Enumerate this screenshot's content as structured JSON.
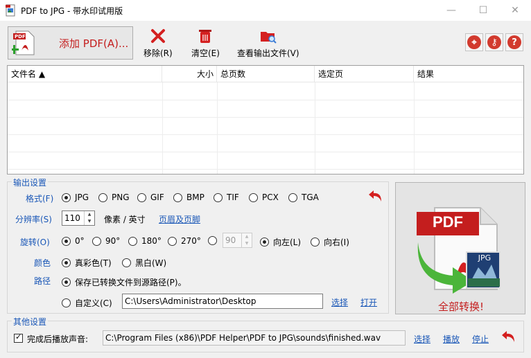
{
  "window": {
    "title": "PDF to JPG - 带水印试用版"
  },
  "toolbar": {
    "add_pdf": "添加 PDF(A)...",
    "remove": "移除(R)",
    "clear": "清空(E)",
    "view_output": "查看输出文件(V)"
  },
  "file_list": {
    "columns": [
      "文件名 ▲",
      "大小",
      "总页数",
      "选定页",
      "结果"
    ],
    "rows": []
  },
  "output_settings": {
    "title": "输出设置",
    "format_label": "格式(F)",
    "formats": [
      "JPG",
      "PNG",
      "GIF",
      "BMP",
      "TIF",
      "PCX",
      "TGA"
    ],
    "selected_format": "JPG",
    "resolution_label": "分辨率(S)",
    "resolution_value": "110",
    "resolution_unit": "像素 / 英寸",
    "header_footer_link": "页眉及页脚",
    "rotation_label": "旋转(O)",
    "rotations": [
      "0°",
      "90°",
      "180°",
      "270°"
    ],
    "selected_rotation": "0°",
    "custom_rotation_value": "90",
    "rotate_left": "向左(L)",
    "rotate_right": "向右(I)",
    "selected_direction": "向左(L)",
    "color_label": "颜色",
    "color_true": "真彩色(T)",
    "color_bw": "黑白(W)",
    "selected_color": "真彩色(T)",
    "path_label": "路径",
    "path_source": "保存已转换文件到源路径(P)。",
    "path_custom": "自定义(C)",
    "custom_path_value": "C:\\Users\\Administrator\\Desktop",
    "browse_link": "选择",
    "open_link": "打开"
  },
  "convert": {
    "label": "全部转换!",
    "pdf_badge": "PDF",
    "jpg_badge": "JPG"
  },
  "other_settings": {
    "title": "其他设置",
    "sound_label": "完成后播放声音:",
    "sound_checked": true,
    "sound_path": "C:\\Program Files (x86)\\PDF Helper\\PDF to JPG\\sounds\\finished.wav",
    "browse_link": "选择",
    "play_link": "播放",
    "stop_link": "停止"
  },
  "colors": {
    "accent_blue": "#1a57b7",
    "accent_red": "#c41e1e"
  },
  "icons": {
    "add_pdf": "pdf-add-icon",
    "remove": "red-x-icon",
    "clear": "trash-icon",
    "view_output": "folder-search-icon",
    "undo": "undo-arrow-icon",
    "web": "globe-icon",
    "key": "key-icon",
    "help": "help-icon"
  }
}
